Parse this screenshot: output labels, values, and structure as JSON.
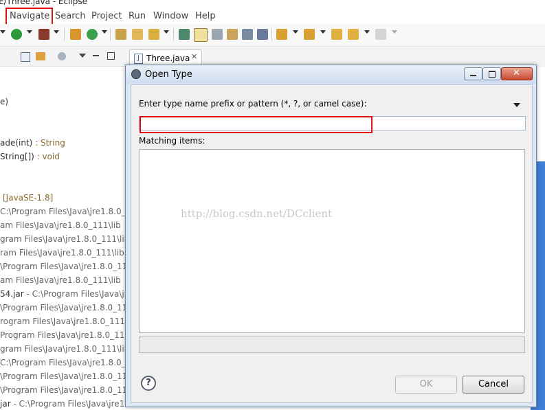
{
  "window": {
    "title": "E/Three.java - Eclipse"
  },
  "menubar": {
    "items": [
      "Navigate",
      "Search",
      "Project",
      "Run",
      "Window",
      "Help"
    ]
  },
  "left_tree": {
    "lines": [
      {
        "text": "e)",
        "ret": ""
      },
      {
        "text": "ade(int)",
        "ret": " : String"
      },
      {
        "text": "String[])",
        "ret": " : void"
      },
      {
        "text": "[JavaSE-1.8]",
        "ret": ""
      },
      {
        "text": "C:\\Program Files\\Java\\jre1.8.0_1",
        "ret": ""
      },
      {
        "text": "am Files\\Java\\jre1.8.0_111\\lib",
        "ret": ""
      },
      {
        "text": "gram Files\\Java\\jre1.8.0_111\\lib",
        "ret": ""
      },
      {
        "text": "ram Files\\Java\\jre1.8.0_111\\lib",
        "ret": ""
      },
      {
        "text": "\\Program Files\\Java\\jre1.8.0_11",
        "ret": ""
      },
      {
        "text": "am Files\\Java\\jre1.8.0_111\\lib",
        "ret": ""
      },
      {
        "text": "54.jar",
        "ret": " - C:\\Program Files\\Java\\jr"
      },
      {
        "text": "\\Program Files\\Java\\jre1.8.0_11",
        "ret": ""
      },
      {
        "text": "rogram Files\\Java\\jre1.8.0_111\\",
        "ret": ""
      },
      {
        "text": "Program Files\\Java\\jre1.8.0_111",
        "ret": ""
      },
      {
        "text": "gram Files\\Java\\jre1.8.0_111\\lib",
        "ret": ""
      },
      {
        "text": "C:\\Program Files\\Java\\jre1.8.0_",
        "ret": ""
      },
      {
        "text": "\\Program Files\\Java\\jre1.8.0_11",
        "ret": ""
      },
      {
        "text": "\\Program Files\\Java\\jre1.8.0_11",
        "ret": ""
      },
      {
        "text": "jar",
        "ret": " - C:\\Program Files\\Java\\jre1."
      }
    ]
  },
  "editor": {
    "tab_label": "Three.java"
  },
  "dialog": {
    "title": "Open Type",
    "prompt_label": "Enter type name prefix or pattern (*, ?, or camel case):",
    "search_value": "",
    "matching_label": "Matching items:",
    "watermark": "http://blog.csdn.net/DCclient",
    "help_glyph": "?",
    "ok_label": "OK",
    "cancel_label": "Cancel"
  },
  "colors": {
    "highlight_box": "#e01010",
    "dialog_frame": "#dde6f3",
    "right_strip": "#3f7fd8"
  }
}
